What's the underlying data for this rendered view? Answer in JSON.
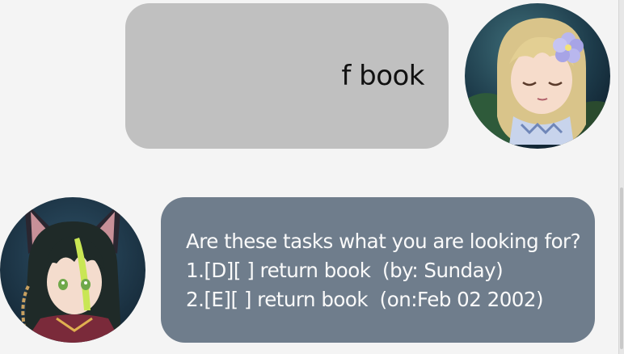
{
  "conversation": {
    "user_message": {
      "text": "f book",
      "avatar_icon": "blonde-girl-with-flower-avatar"
    },
    "bot_message": {
      "lines": [
        "Are these tasks what you are looking for?",
        "1.[D][ ] return book  (by: Sunday)",
        "2.[E][ ] return book  (on:Feb 02 2002)"
      ],
      "avatar_icon": "dark-haired-fox-ear-character-avatar"
    }
  },
  "colors": {
    "background": "#f4f4f4",
    "user_bubble": "#c0c0c0",
    "bot_bubble": "#6f7d8c",
    "bot_text": "#fafafa"
  }
}
